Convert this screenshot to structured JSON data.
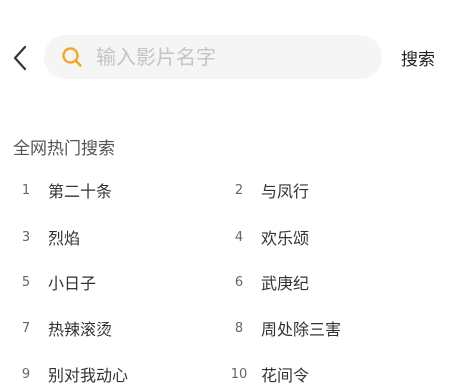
{
  "search": {
    "placeholder": "输入影片名字",
    "button_label": "搜索"
  },
  "hot_search": {
    "title": "全网热门搜索",
    "items": [
      {
        "rank": "1",
        "name": "第二十条"
      },
      {
        "rank": "2",
        "name": "与凤行"
      },
      {
        "rank": "3",
        "name": "烈焰"
      },
      {
        "rank": "4",
        "name": "欢乐颂"
      },
      {
        "rank": "5",
        "name": "小日子"
      },
      {
        "rank": "6",
        "name": "武庚纪"
      },
      {
        "rank": "7",
        "name": "热辣滚烫"
      },
      {
        "rank": "8",
        "name": "周处除三害"
      },
      {
        "rank": "9",
        "name": "别对我动心"
      },
      {
        "rank": "10",
        "name": "花间令"
      }
    ]
  },
  "colors": {
    "accent": "#f5a623",
    "search_bg": "#f5f5f5"
  },
  "icons": {
    "back": "chevron-left-icon",
    "search": "search-icon"
  }
}
